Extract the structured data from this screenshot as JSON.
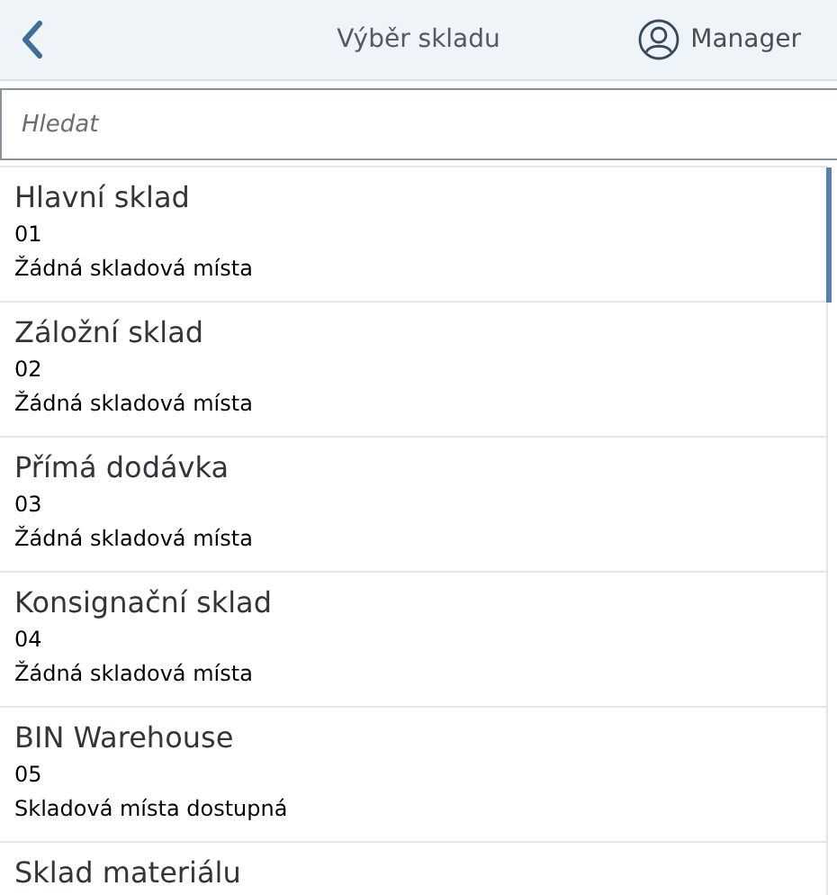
{
  "header": {
    "title": "Výběr skladu",
    "user": "Manager"
  },
  "search": {
    "placeholder": "Hledat"
  },
  "warehouses": [
    {
      "name": "Hlavní sklad",
      "code": "01",
      "status": "Žádná skladová místa"
    },
    {
      "name": "Záložní sklad",
      "code": "02",
      "status": "Žádná skladová místa"
    },
    {
      "name": "Přímá dodávka",
      "code": "03",
      "status": "Žádná skladová místa"
    },
    {
      "name": "Konsignační sklad",
      "code": "04",
      "status": "Žádná skladová místa"
    },
    {
      "name": "BIN Warehouse",
      "code": "05",
      "status": "Skladová místa dostupná"
    },
    {
      "name": "Sklad materiálu"
    }
  ]
}
